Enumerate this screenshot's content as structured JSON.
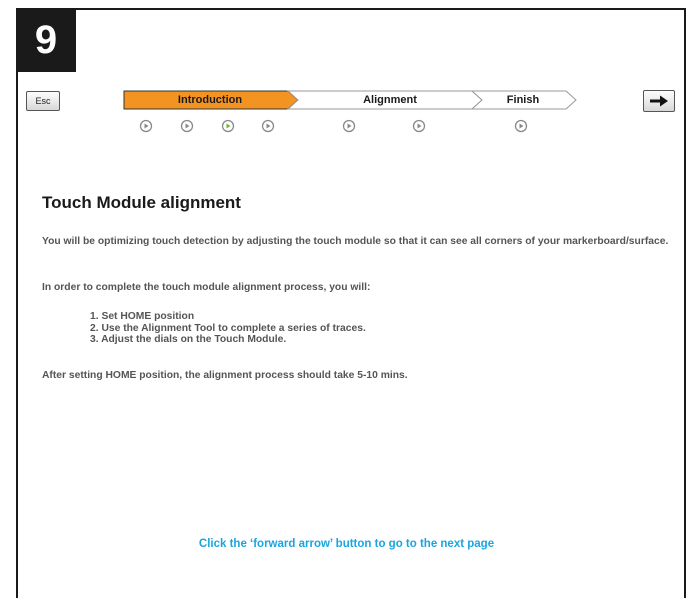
{
  "step_number": "9",
  "esc_label": "Esc",
  "progress": {
    "segments": [
      {
        "label": "Introduction",
        "state": "active"
      },
      {
        "label": "Alignment",
        "state": "inactive"
      },
      {
        "label": "Finish",
        "state": "inactive"
      }
    ],
    "active_color": "#f39322",
    "dots": [
      {
        "state": "inactive"
      },
      {
        "state": "inactive"
      },
      {
        "state": "current"
      },
      {
        "state": "inactive"
      },
      {
        "state": "inactive"
      },
      {
        "state": "inactive"
      },
      {
        "state": "inactive"
      }
    ]
  },
  "content": {
    "title": "Touch Module alignment",
    "para1": "You will be optimizing touch detection by adjusting the touch module so that it can see all corners of your markerboard/surface.",
    "para2": "In order to complete the touch module alignment process, you will:",
    "steps": [
      "1. Set HOME position",
      "2. Use the Alignment Tool to complete a series of traces.",
      "3. Adjust the dials on the Touch Module."
    ],
    "para3": "After setting HOME position, the alignment process should take 5-10 mins."
  },
  "hint": "Click the ‘forward arrow’ button to go to the next page",
  "icons": {
    "forward": "right-arrow-icon",
    "dot": "play-circle-icon"
  },
  "colors": {
    "hint": "#1aa5e0",
    "current_dot": "#6dbb2a"
  }
}
